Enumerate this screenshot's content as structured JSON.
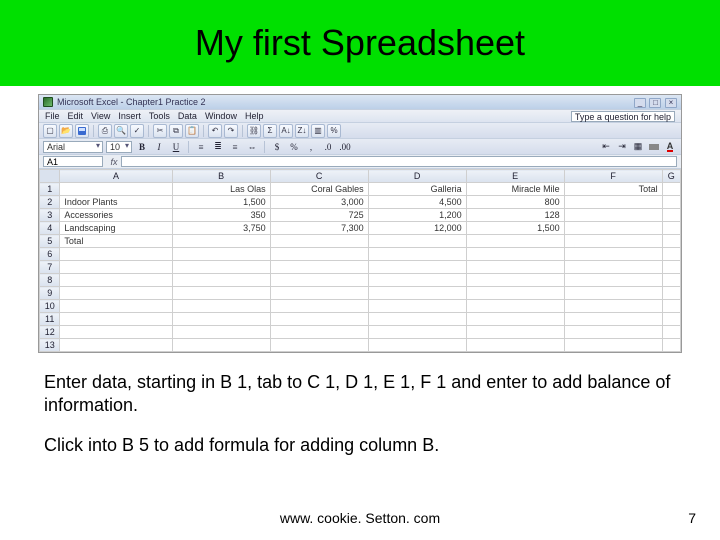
{
  "title": "My first Spreadsheet",
  "excel": {
    "titlebar": "Microsoft Excel - Chapter1 Practice 2",
    "menus": [
      "File",
      "Edit",
      "View",
      "Insert",
      "Tools",
      "Data",
      "Window",
      "Help"
    ],
    "help_placeholder": "Type a question for help",
    "font_name": "Arial",
    "font_size": "10",
    "name_box": "A1",
    "columns": [
      "A",
      "B",
      "C",
      "D",
      "E",
      "F"
    ],
    "totalCol": "G",
    "row_numbers": [
      "1",
      "2",
      "3",
      "4",
      "5",
      "6",
      "7",
      "8",
      "9",
      "10",
      "11",
      "12",
      "13"
    ],
    "header_row": [
      "",
      "Las Olas",
      "Coral Gables",
      "Galleria",
      "Miracle Mile",
      "Total"
    ],
    "rows": [
      [
        "Indoor Plants",
        "1,500",
        "3,000",
        "4,500",
        "800",
        ""
      ],
      [
        "Accessories",
        "350",
        "725",
        "1,200",
        "128",
        ""
      ],
      [
        "Landscaping",
        "3,750",
        "7,300",
        "12,000",
        "1,500",
        ""
      ],
      [
        "Total",
        "",
        "",
        "",
        "",
        ""
      ]
    ],
    "toolbar_icons": [
      "new-icon",
      "open-icon",
      "save-icon",
      "print-icon",
      "print-preview-icon",
      "spellcheck-icon",
      "cut-icon",
      "copy-icon",
      "paste-icon",
      "undo-icon",
      "redo-icon",
      "hyperlink-icon",
      "autosum-icon",
      "sort-asc-icon",
      "sort-desc-icon",
      "chart-icon",
      "zoom-icon"
    ],
    "fmt_buttons": {
      "bold": "B",
      "italic": "I",
      "underline": "U"
    },
    "align_icons": [
      "align-left-icon",
      "align-center-icon",
      "align-right-icon",
      "merge-center-icon"
    ],
    "number_icons": [
      "currency-icon",
      "percent-icon",
      "comma-icon",
      "decrease-decimal-icon",
      "increase-decimal-icon"
    ],
    "right_icons": [
      "decrease-indent-icon",
      "increase-indent-icon",
      "borders-icon",
      "fill-color-icon",
      "font-color-icon"
    ]
  },
  "paragraph1": "Enter data, starting in B 1, tab to C 1, D 1, E 1, F 1 and enter to add balance of information.",
  "paragraph2": "Click into B 5 to add formula for adding column B.",
  "footer_url": "www. cookie. Setton. com",
  "page_number": "7",
  "chart_data": {
    "type": "table",
    "title": "My first Spreadsheet",
    "columns": [
      "Las Olas",
      "Coral Gables",
      "Galleria",
      "Miracle Mile"
    ],
    "rows": [
      "Indoor Plants",
      "Accessories",
      "Landscaping"
    ],
    "values": [
      [
        1500,
        3000,
        4500,
        800
      ],
      [
        350,
        725,
        1200,
        128
      ],
      [
        3750,
        7300,
        12000,
        1500
      ]
    ]
  }
}
